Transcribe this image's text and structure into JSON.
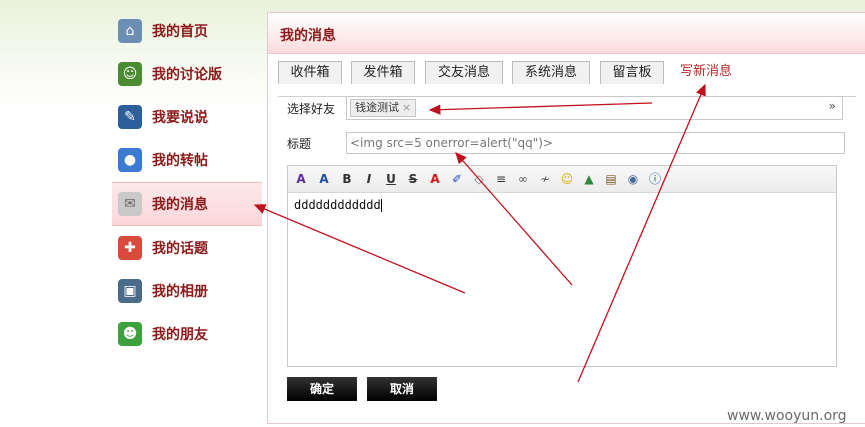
{
  "sidebar": {
    "items": [
      {
        "label": "我的首页",
        "icon": "home-icon",
        "glyph": "⌂",
        "color": "#6b8fb3"
      },
      {
        "label": "我的讨论版",
        "icon": "users-icon",
        "glyph": "☺",
        "color": "#4a8c2f"
      },
      {
        "label": "我要说说",
        "icon": "person-writing-icon",
        "glyph": "✎",
        "color": "#2d5f9a"
      },
      {
        "label": "我的转帖",
        "icon": "video-camera-icon",
        "glyph": "●",
        "color": "#3b7bd0"
      },
      {
        "label": "我的消息",
        "icon": "envelope-icon",
        "glyph": "✉",
        "color": "#c9c9c9"
      },
      {
        "label": "我的话题",
        "icon": "lifebuoy-icon",
        "glyph": "✚",
        "color": "#d84b3b"
      },
      {
        "label": "我的相册",
        "icon": "photo-album-icon",
        "glyph": "▣",
        "color": "#4a6b8a"
      },
      {
        "label": "我的朋友",
        "icon": "friends-icon",
        "glyph": "☻",
        "color": "#3da23d"
      }
    ],
    "active_index": 4
  },
  "panel": {
    "title": "我的消息",
    "tabs": [
      "收件箱",
      "发件箱",
      "交友消息",
      "系统消息",
      "留言板",
      "写新消息"
    ],
    "active_tab": "写新消息"
  },
  "form": {
    "friend_label": "选择好友",
    "friend_chip": "钱途测试",
    "chip_remove": "×",
    "friend_dropdown_icon": "double-chevron-down-icon",
    "title_label": "标题",
    "title_value": "<img src=5 onerror=alert(\"qq\")>",
    "editor_content": "dddddddddddd",
    "toolbar_icons": [
      "spellcheck-icon",
      "font-size-icon",
      "bold-icon",
      "italic-icon",
      "underline-icon",
      "strikethrough-icon",
      "font-color-icon",
      "highlight-color-icon",
      "eraser-icon",
      "align-icon",
      "link-icon",
      "unlink-icon",
      "smiley-icon",
      "image-upload-icon",
      "insert-file-icon",
      "insert-media-icon",
      "info-icon"
    ]
  },
  "buttons": {
    "confirm": "确定",
    "cancel": "取消"
  },
  "watermark": "www.wooyun.org",
  "colors": {
    "accent": "#8b1a1a",
    "annotation_arrow": "#c0111f"
  }
}
